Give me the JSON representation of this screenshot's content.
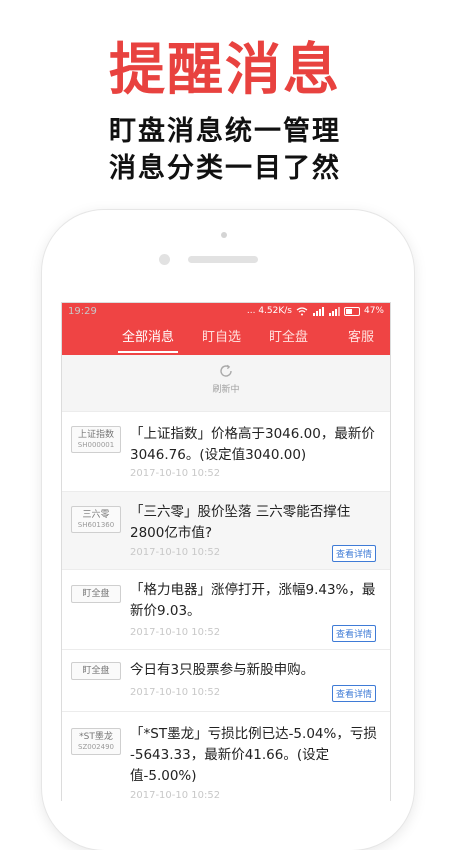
{
  "hero": {
    "title": "提醒消息",
    "line1": "盯盘消息统一管理",
    "line2": "消息分类一目了然"
  },
  "status_bar": {
    "time": "19:29",
    "speed": "... 4.52K/s",
    "battery": "47%"
  },
  "tabs": [
    {
      "label": "全部消息",
      "active": true
    },
    {
      "label": "盯自选",
      "active": false
    },
    {
      "label": "盯全盘",
      "active": false
    },
    {
      "label": "客服",
      "active": false
    }
  ],
  "refresh_label": "刷新中",
  "detail_label": "查看详情",
  "messages": [
    {
      "tag_name": "上证指数",
      "tag_code": "SH000001",
      "text": "「上证指数」价格高于3046.00，最新价3046.76。(设定值3040.00)",
      "time": "2017-10-10 10:52",
      "has_detail": false
    },
    {
      "tag_name": "三六零",
      "tag_code": "SH601360",
      "text": "「三六零」股价坠落 三六零能否撑住2800亿市值?",
      "time": "2017-10-10 10:52",
      "has_detail": true
    },
    {
      "tag_name": "盯全盘",
      "tag_code": "",
      "text": "「格力电器」涨停打开，涨幅9.43%，最新价9.03。",
      "time": "2017-10-10 10:52",
      "has_detail": true
    },
    {
      "tag_name": "盯全盘",
      "tag_code": "",
      "text": "今日有3只股票参与新股申购。",
      "time": "2017-10-10 10:52",
      "has_detail": true
    },
    {
      "tag_name": "*ST墨龙",
      "tag_code": "SZ002490",
      "text": "「*ST墨龙」亏损比例已达-5.04%，亏损 -5643.33，最新价41.66。(设定值-5.00%)",
      "time": "2017-10-10 10:52",
      "has_detail": false
    }
  ],
  "colors": {
    "accent": "#ef4444",
    "hero_red": "#e8423f",
    "link_blue": "#3f7bd6"
  }
}
